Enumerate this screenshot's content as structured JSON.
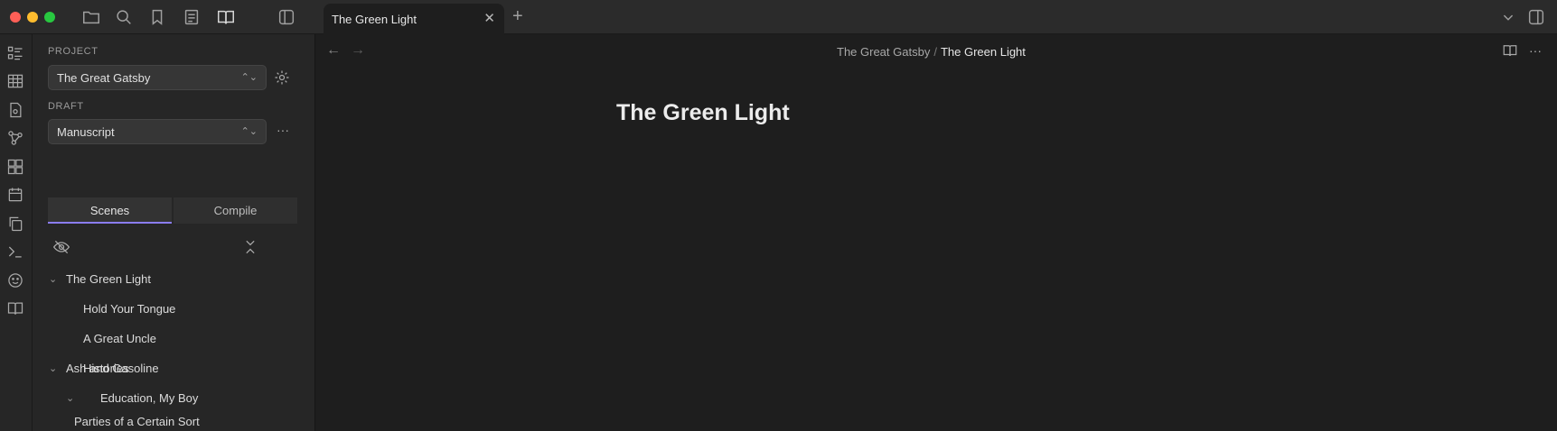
{
  "window": {
    "traffic_colors": [
      "#ff5f57",
      "#febc2e",
      "#28c840"
    ],
    "toolbar_icons": [
      "folder-icon",
      "search-icon",
      "bookmark-icon",
      "document-icon",
      "book-icon",
      "sidebar-toggle-icon"
    ]
  },
  "tabs": [
    {
      "label": "The Green Light",
      "close": "✕"
    }
  ],
  "new_tab": "+",
  "sidebar": {
    "project_label": "PROJECT",
    "project_value": "The Great Gatsby",
    "draft_label": "DRAFT",
    "draft_value": "Manuscript",
    "more": "···",
    "tabs": [
      "Scenes",
      "Compile"
    ],
    "tree": [
      {
        "label": "The Green Light",
        "depth": 0,
        "expanded": true
      },
      {
        "label": "Hold Your Tongue",
        "depth": 1
      },
      {
        "label": "A Great Uncle",
        "depth": 1
      },
      {
        "label": "Ash and Gasoline",
        "depth": 0,
        "expanded": true
      },
      {
        "label": "Histories",
        "depth": 1,
        "expanded": true
      },
      {
        "label": "Education, My Boy",
        "depth": 2
      },
      {
        "label": "Parties of a Certain Sort",
        "depth": 0
      }
    ]
  },
  "main": {
    "back": "←",
    "forward": "→",
    "breadcrumb": {
      "parent": "The Great Gatsby",
      "separator": "/",
      "current": "The Green Light"
    },
    "title": "The Green Light",
    "more": "···"
  }
}
